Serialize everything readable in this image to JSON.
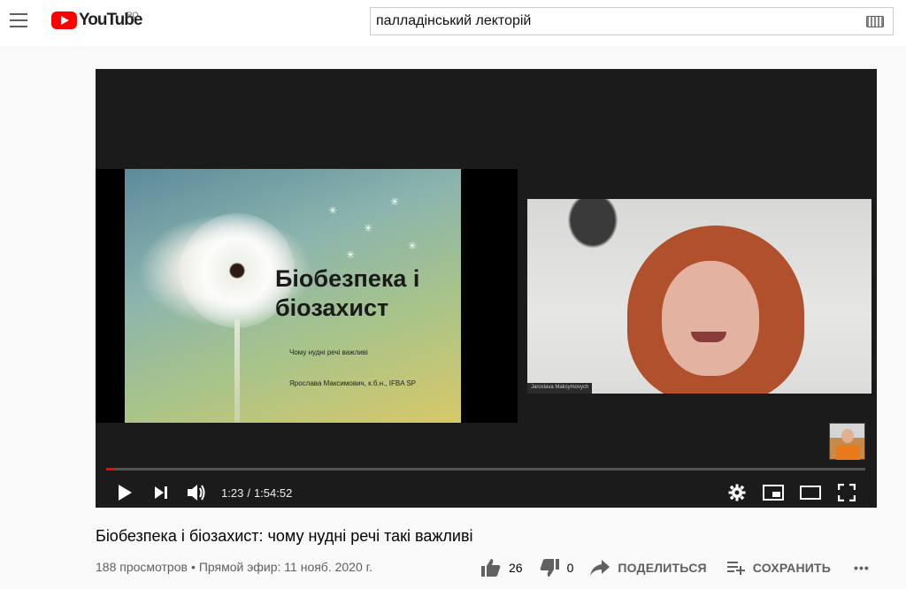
{
  "header": {
    "logo_text": "YouTube",
    "region": "RO",
    "search_value": "палладінський лекторій"
  },
  "player": {
    "slide": {
      "title_line1": "Біобезпека і",
      "title_line2": "біозахист",
      "subtitle": "Чому нудні речі важливі",
      "author": "Ярослава Максимович, к.б.н., IFBA SP"
    },
    "camera_label": "Jaroslava Maksymovych",
    "current_time": "1:23",
    "separator": "/",
    "duration": "1:54:52",
    "progress": 0.012
  },
  "video": {
    "title": "Біобезпека і біозахист: чому нудні речі такі важливі",
    "views": "188 просмотров",
    "bullet": "•",
    "date": "Прямой эфир: 11 нояб. 2020 г.",
    "likes": "26",
    "dislikes": "0",
    "share_label": "ПОДЕЛИТЬСЯ",
    "save_label": "СОХРАНИТЬ",
    "more_label": "•••"
  },
  "colors": {
    "brand_red": "#ff0000",
    "progress_red": "#ff0000",
    "text_secondary": "#606060"
  },
  "icons": {
    "menu": "hamburger-icon",
    "keyboard": "keyboard-icon",
    "play": "play-icon",
    "next": "next-icon",
    "volume": "volume-icon",
    "settings": "gear-icon",
    "miniplayer": "miniplayer-icon",
    "theater": "theater-icon",
    "fullscreen": "fullscreen-icon",
    "like": "thumbs-up-icon",
    "dislike": "thumbs-down-icon",
    "share": "share-icon",
    "save": "playlist-add-icon",
    "more": "more-icon"
  }
}
